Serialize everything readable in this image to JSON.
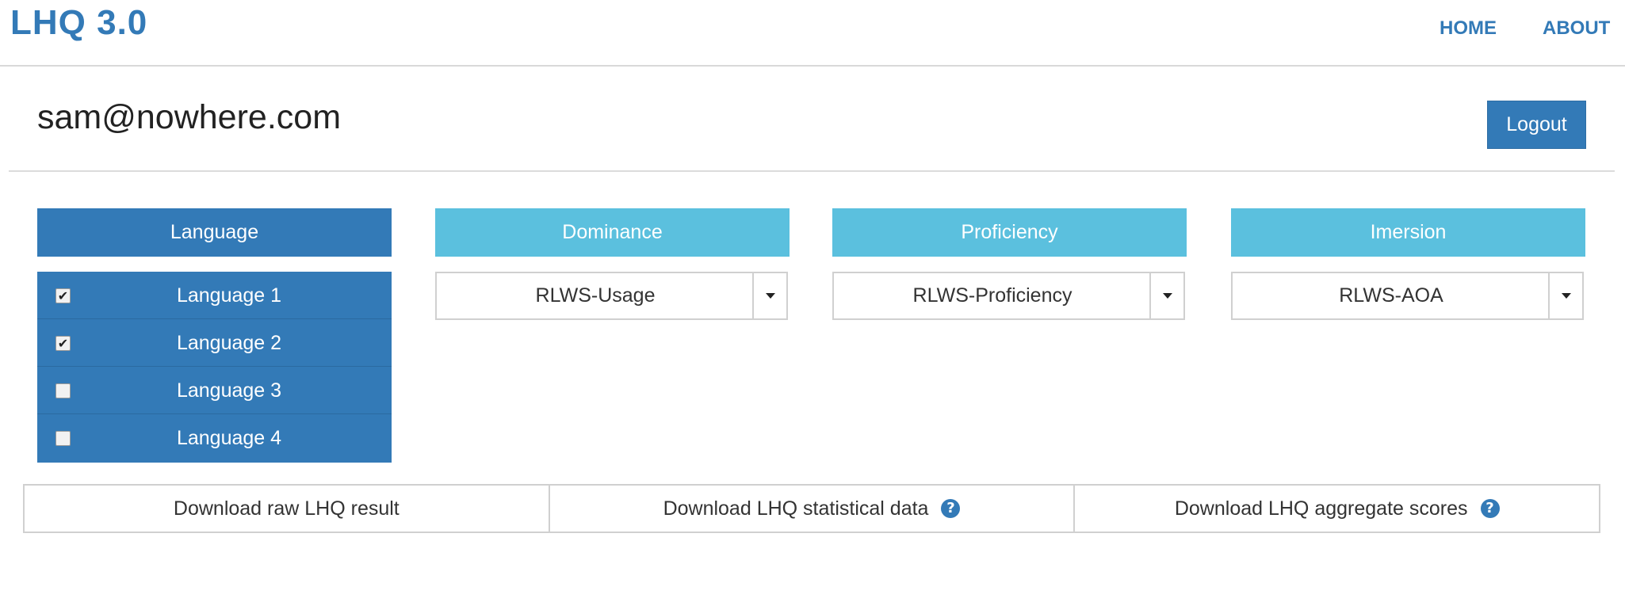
{
  "app": {
    "brand": "LHQ 3.0",
    "nav": {
      "home": "HOME",
      "about": "ABOUT"
    }
  },
  "user": {
    "email": "sam@nowhere.com",
    "logout_label": "Logout"
  },
  "columns": {
    "language": "Language",
    "dominance": "Dominance",
    "proficiency": "Proficiency",
    "imersion": "Imersion"
  },
  "languages": [
    {
      "label": "Language 1",
      "checked": true,
      "mark": "✔"
    },
    {
      "label": "Language 2",
      "checked": true,
      "mark": "✔"
    },
    {
      "label": "Language 3",
      "checked": false,
      "mark": ""
    },
    {
      "label": "Language 4",
      "checked": false,
      "mark": ""
    }
  ],
  "selects": {
    "dominance": "RLWS-Usage",
    "proficiency": "RLWS-Proficiency",
    "imersion": "RLWS-AOA"
  },
  "downloads": {
    "raw": "Download raw LHQ result",
    "statistical": "Download LHQ statistical data",
    "aggregate": "Download LHQ aggregate scores",
    "help_glyph": "?"
  },
  "icons": {
    "help": "question-circle-icon",
    "caret": "caret-down-icon",
    "checkbox": "checkbox-icon"
  },
  "colors": {
    "primary": "#337ab7",
    "info": "#5bc0de",
    "border": "#d0d0d0"
  }
}
